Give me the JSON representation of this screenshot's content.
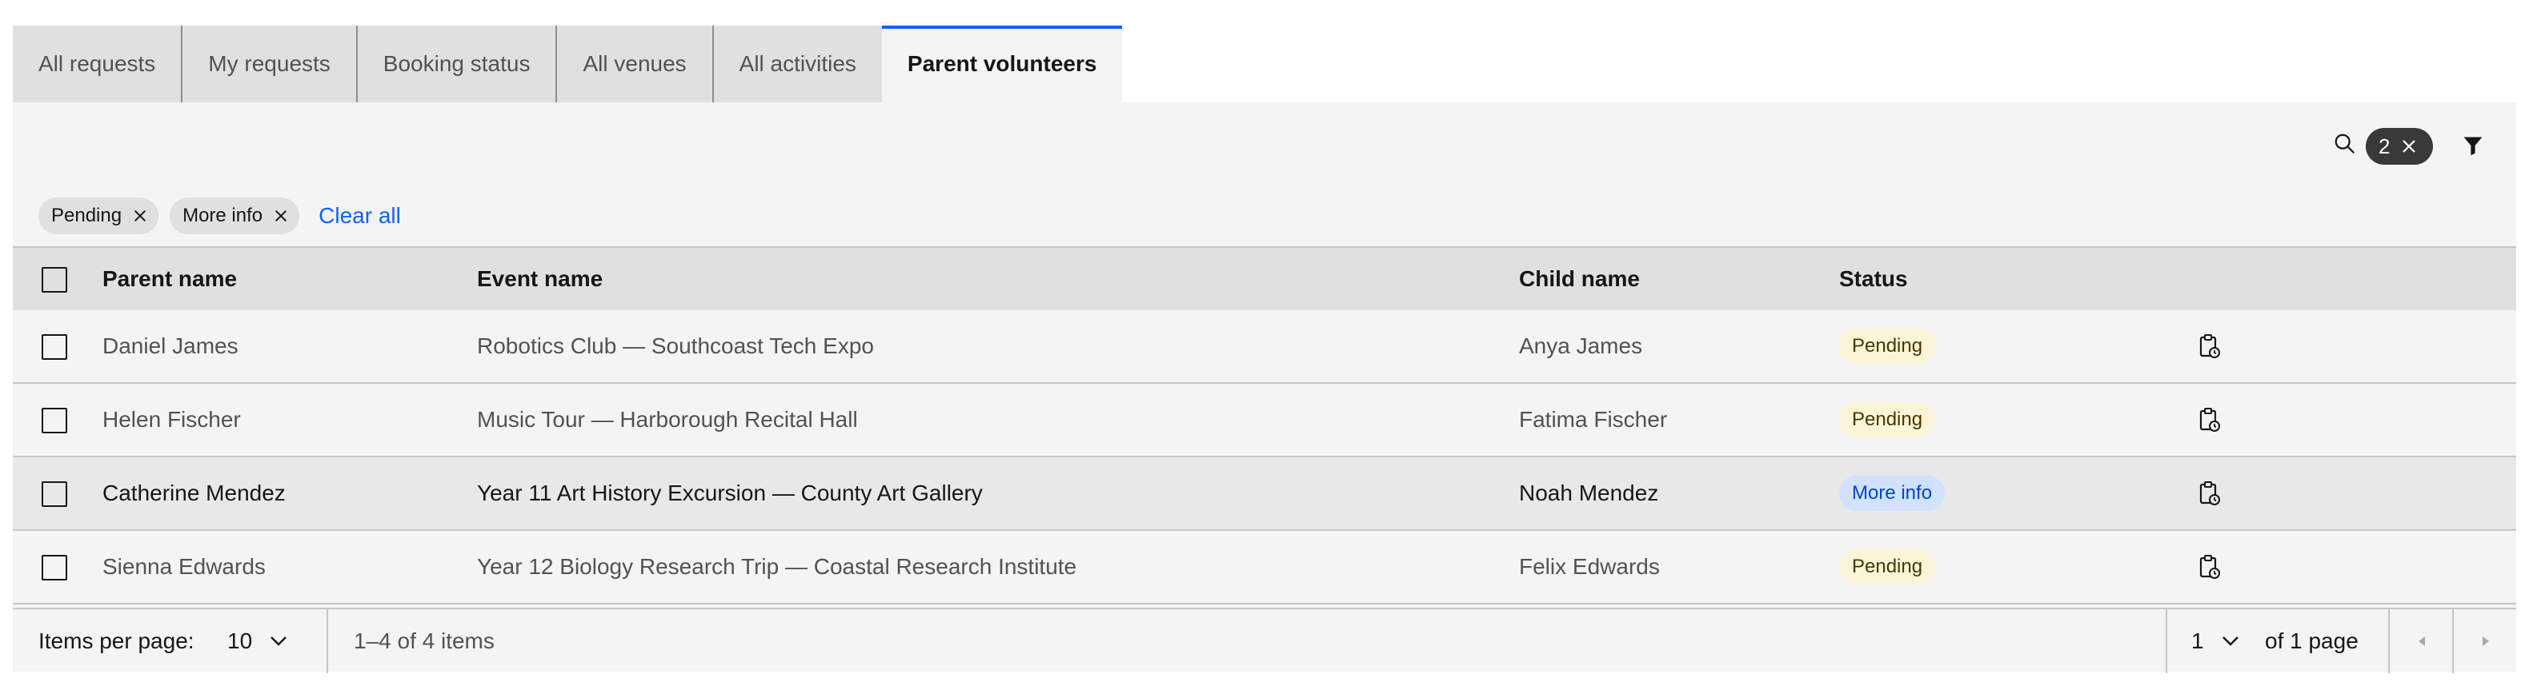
{
  "tabs": [
    {
      "label": "All requests"
    },
    {
      "label": "My requests"
    },
    {
      "label": "Booking status"
    },
    {
      "label": "All venues"
    },
    {
      "label": "All activities"
    },
    {
      "label": "Parent volunteers"
    }
  ],
  "toolbar": {
    "filter_count": "2"
  },
  "filters": {
    "tags": [
      {
        "label": "Pending"
      },
      {
        "label": "More info"
      }
    ],
    "clear_label": "Clear all"
  },
  "table": {
    "headers": {
      "parent": "Parent name",
      "event": "Event name",
      "child": "Child name",
      "status": "Status"
    },
    "rows": [
      {
        "parent": "Daniel James",
        "event": "Robotics Club — Southcoast Tech Expo",
        "child": "Anya James",
        "status": "Pending"
      },
      {
        "parent": "Helen Fischer",
        "event": "Music Tour — Harborough Recital Hall",
        "child": "Fatima Fischer",
        "status": "Pending"
      },
      {
        "parent": "Catherine Mendez",
        "event": "Year 11 Art History Excursion — County Art Gallery",
        "child": "Noah Mendez",
        "status": "More info"
      },
      {
        "parent": "Sienna Edwards",
        "event": "Year 12 Biology Research Trip — Coastal Research Institute",
        "child": "Felix Edwards",
        "status": "Pending"
      }
    ]
  },
  "pagination": {
    "items_per_page_label": "Items per page:",
    "items_per_page": "10",
    "range_text": "1–4 of 4 items",
    "page": "1",
    "of_pages": "of 1 page"
  },
  "colors": {
    "accent": "#0f62fe",
    "pending_bg": "#fcf4d6",
    "moreinfo_bg": "#d0e2ff"
  },
  "icons": [
    "search-icon",
    "close-icon",
    "filter-icon",
    "clipboard-icon",
    "chevron-down-icon",
    "caret-left-icon",
    "caret-right-icon"
  ]
}
